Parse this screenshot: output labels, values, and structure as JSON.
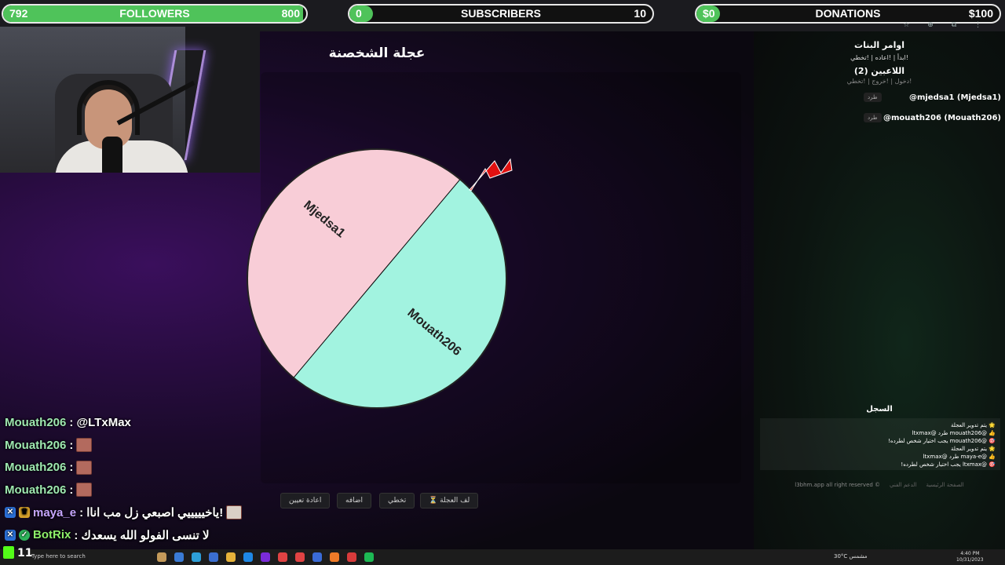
{
  "overlay": {
    "followers": {
      "current": "792",
      "label": "FOLLOWERS",
      "goal": "800",
      "progress": 0.99
    },
    "subscribers": {
      "current": "0",
      "label": "SUBSCRIBERS",
      "goal": "10",
      "progress": 0.0
    },
    "donations": {
      "current": "$0",
      "label": "DONATIONS",
      "goal": "$100",
      "progress": 0.0
    }
  },
  "wheel": {
    "title": "عجلة الشخصنة",
    "segments": [
      {
        "label": "Mjedsa1",
        "color": "#f8cdd7"
      },
      {
        "label": "Mouath206",
        "color": "#a2f3e0"
      }
    ],
    "buttons": {
      "reset": "اعادة تعيين",
      "add": "اضافه",
      "skip": "تخطي",
      "spin": "⏳ لف العجلة"
    }
  },
  "chat": [
    {
      "user": "Mouath206",
      "message": ": @LTxMax",
      "emote": false
    },
    {
      "user": "Mouath206",
      "message": ":",
      "emote": true
    },
    {
      "user": "Mouath206",
      "message": ":",
      "emote": true
    },
    {
      "user": "Mouath206",
      "message": ":",
      "emote": true
    },
    {
      "user": "maya_e",
      "message": ": ياخيييييي اصبعي زل مب اناا!",
      "emote": true
    },
    {
      "user": "BotRix",
      "message": ": لا تنسى الفولو الله يسعدك",
      "emote": false
    }
  ],
  "sidebar": {
    "commands_title": "اوامر البنات",
    "commands": "!ابدأ | !اعاده | !تخطي",
    "players_title": "اللاعبين (2)",
    "players_links": "!دخول | !خروج | !تخطي",
    "kick_label": "طرد",
    "players": [
      "@mjedsa1 (Mjedsa1)",
      "@mouath206 (Mouath206)"
    ],
    "log_title": "السجل",
    "log": [
      "🌟 يتم تدوير العجلة",
      "👍 @mouath206 طرد @ltxmax",
      "🎯 @mouath206 يجب اختيار شخص لطرده!",
      "🌟 يتم تدوير العجلة",
      "👍 @maya-e طرد @ltxmax",
      "🎯 @ltxmax يجب اختيار شخص لطرده!"
    ],
    "footer": [
      "الصفحة الرئيسية",
      "الدعم الفني",
      "l3bhm.app all right reserved ©"
    ]
  },
  "taskbar": {
    "count": "11",
    "search_placeholder": "Type here to search",
    "weather": "30°C مشمس",
    "time": "4:40 PM",
    "date": "10/31/2023"
  }
}
